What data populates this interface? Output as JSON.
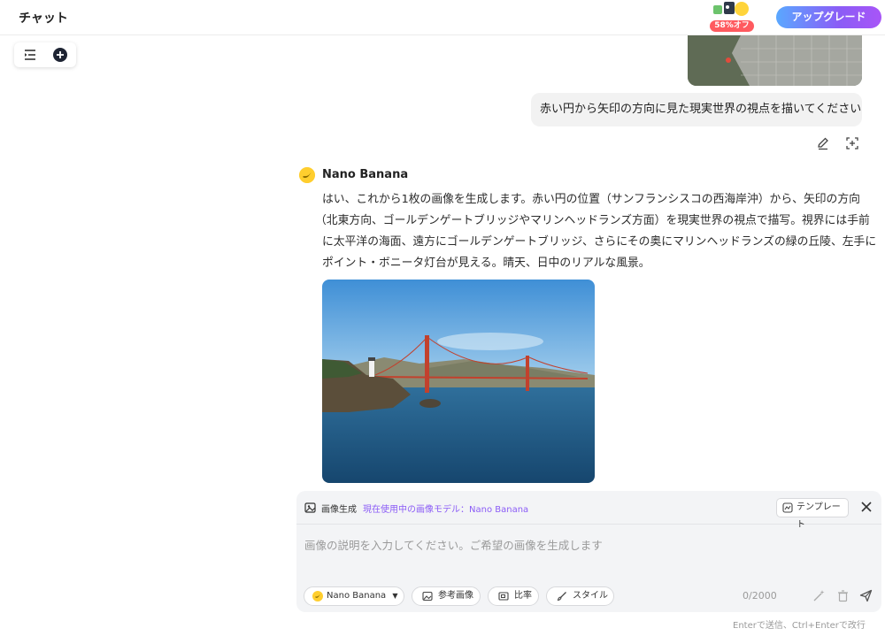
{
  "header": {
    "title": "チャット",
    "promo_badge": "58%オフ",
    "upgrade_label": "アップグレード"
  },
  "conversation": {
    "user_message": "赤い円から矢印の方向に見た現実世界の視点を描いてください",
    "assistant_name": "Nano Banana",
    "assistant_lines": [
      "はい、これから1枚の画像を生成します。赤い円の位置（サンフランシスコの西海岸沖）から、矢印の方向",
      "（北東方向、ゴールデンゲートブリッジやマリンヘッドランズ方面）を現実世界の視点で描写。視界には手前",
      "に太平洋の海面、遠方にゴールデンゲートブリッジ、さらにその奥にマリンヘッドランズの緑の丘陵、左手に",
      "ポイント・ボニータ灯台が見える。晴天、日中のリアルな風景。"
    ]
  },
  "composer": {
    "mode_label": "画像生成",
    "model_label": "現在使用中の画像モデル：Nano Banana",
    "template_label": "テンプレート",
    "placeholder": "画像の説明を入力してください。ご希望の画像を生成します",
    "model_chip": "Nano Banana",
    "reference_chip": "参考画像",
    "ratio_chip": "比率",
    "style_chip": "スタイル",
    "counter": "0/2000",
    "hint": "Enterで送信、Ctrl+Enterで改行"
  },
  "colors": {
    "accent_purple": "#8b5cf6",
    "upgrade_gradient_start": "#5aa8ff",
    "promo_red": "#ff5a5f",
    "avatar_yellow": "#ffce2e"
  },
  "icons": [
    "sidebar-toggle-icon",
    "new-chat-icon",
    "edit-icon",
    "crop-icon",
    "banana-icon",
    "image-gen-icon",
    "template-icon",
    "close-icon",
    "image-icon",
    "ratio-icon",
    "brush-icon",
    "magic-icon",
    "trash-icon",
    "send-icon"
  ]
}
